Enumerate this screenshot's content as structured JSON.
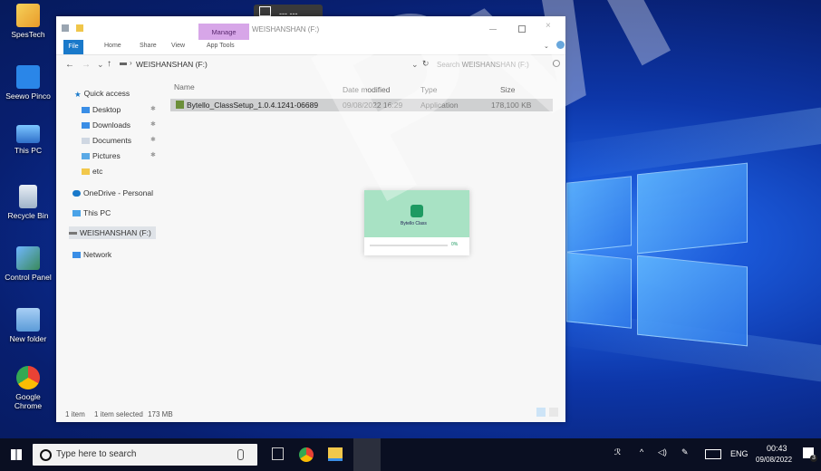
{
  "desktop": {
    "icons": [
      {
        "label": "SpesTech",
        "icon": "spestech-icon"
      },
      {
        "label": "Seewo Pinco",
        "icon": "seewo-pinco-icon"
      },
      {
        "label": "This PC",
        "icon": "this-pc-icon"
      },
      {
        "label": "Recycle Bin",
        "icon": "recycle-bin-icon"
      },
      {
        "label": "Control Panel",
        "icon": "control-panel-icon"
      },
      {
        "label": "New folder",
        "icon": "folder-icon"
      },
      {
        "label": "Google Chrome",
        "icon": "chrome-icon"
      }
    ]
  },
  "remote_bar": {
    "text": "--- ---"
  },
  "explorer": {
    "title": "WEISHANSHAN (F:)",
    "context_tab": "Manage",
    "ribbon_tabs": [
      "File",
      "Home",
      "Share",
      "View",
      "App Tools"
    ],
    "address": "WEISHANSHAN (F:)",
    "search_placeholder": "Search WEISHANSHAN (F:)",
    "nav": {
      "quick_access": "Quick access",
      "items": [
        "Desktop",
        "Downloads",
        "Documents",
        "Pictures",
        "etc"
      ],
      "onedrive": "OneDrive - Personal",
      "this_pc": "This PC",
      "drive": "WEISHANSHAN (F:)",
      "network": "Network"
    },
    "columns": {
      "name": "Name",
      "date": "Date modified",
      "type": "Type",
      "size": "Size"
    },
    "files": [
      {
        "name": "Bytello_ClassSetup_1.0.4.1241-06689",
        "date": "09/08/2022 16:29",
        "type": "Application",
        "size": "178,100 KB"
      }
    ],
    "status": {
      "count": "1 item",
      "selected": "1 item selected",
      "size": "173 MB"
    }
  },
  "installer": {
    "app_name": "Bytello Class",
    "progress_label": "0%"
  },
  "taskbar": {
    "search_placeholder": "Type here to search",
    "lang": "ENG",
    "time": "00:43",
    "date": "09/08/2022",
    "notification_count": "3"
  },
  "watermark": "Pvi"
}
